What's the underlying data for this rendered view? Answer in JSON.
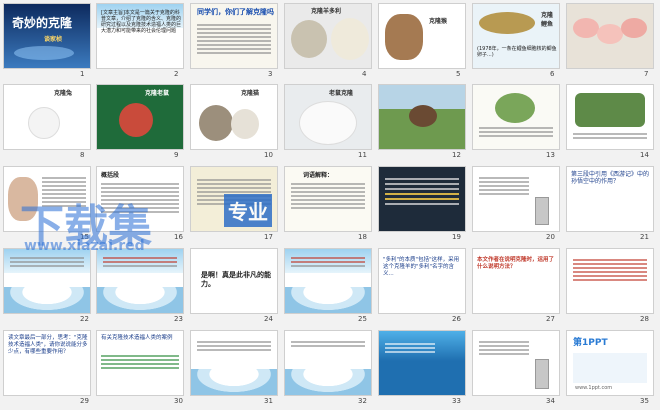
{
  "slides": [
    {
      "num": "1",
      "title": "奇妙的克隆",
      "subtitle": "谈家桢"
    },
    {
      "num": "2",
      "body": "[文章主旨]本文是一篇关于克隆的科普文章，介绍了克隆的含义、克隆的研究过程以及克隆技术造福人类的巨大潜力和可能带来的社会伦理问题"
    },
    {
      "num": "3",
      "title": "同学们，你们了解克隆吗"
    },
    {
      "num": "4",
      "title": "克隆羊多利"
    },
    {
      "num": "5",
      "title": "克隆猴"
    },
    {
      "num": "6",
      "title": "克隆鲤鱼",
      "caption": "(1978年，一条在鲤鱼细胞核的鲫鱼卵子...)"
    },
    {
      "num": "7"
    },
    {
      "num": "8",
      "title": "克隆兔"
    },
    {
      "num": "9",
      "title": "克隆老鼠"
    },
    {
      "num": "10",
      "title": "克隆猫"
    },
    {
      "num": "11",
      "title": "老鼠克隆"
    },
    {
      "num": "12"
    },
    {
      "num": "13"
    },
    {
      "num": "14"
    },
    {
      "num": "15"
    },
    {
      "num": "16",
      "title": "概括段"
    },
    {
      "num": "17"
    },
    {
      "num": "18",
      "title": "词语解释："
    },
    {
      "num": "19"
    },
    {
      "num": "20"
    },
    {
      "num": "21",
      "body": "第三段中引用《西游记》中的孙悟空中的作用？"
    },
    {
      "num": "22"
    },
    {
      "num": "23"
    },
    {
      "num": "24",
      "body": "是啊！真是此非凡的能力。"
    },
    {
      "num": "25"
    },
    {
      "num": "26",
      "body": "\"多利\"的本质\"包括\"这样，采用这个克隆羊的\"多利\"名字的含义..."
    },
    {
      "num": "27",
      "body": "本文作者在说明克隆时，运用了什么说明方法？"
    },
    {
      "num": "28"
    },
    {
      "num": "29",
      "body": "读文章最后一部分，思考：\"克隆技术造福人类\"，请你说说能分多少点，有哪些重要作用？"
    },
    {
      "num": "30",
      "body": "有关克隆技术造福人类的案例"
    },
    {
      "num": "31"
    },
    {
      "num": "32"
    },
    {
      "num": "33"
    },
    {
      "num": "34"
    },
    {
      "num": "35",
      "title": "第1PPT",
      "sub": "www.1ppt.com"
    }
  ],
  "watermark": {
    "brand": "下载集",
    "tag": "专业",
    "url": "www.xiazai.red"
  },
  "colors": {
    "background": "#f2f2f2",
    "watermark": "#2a6fd6",
    "tag_bg": "#2e6fc7"
  }
}
